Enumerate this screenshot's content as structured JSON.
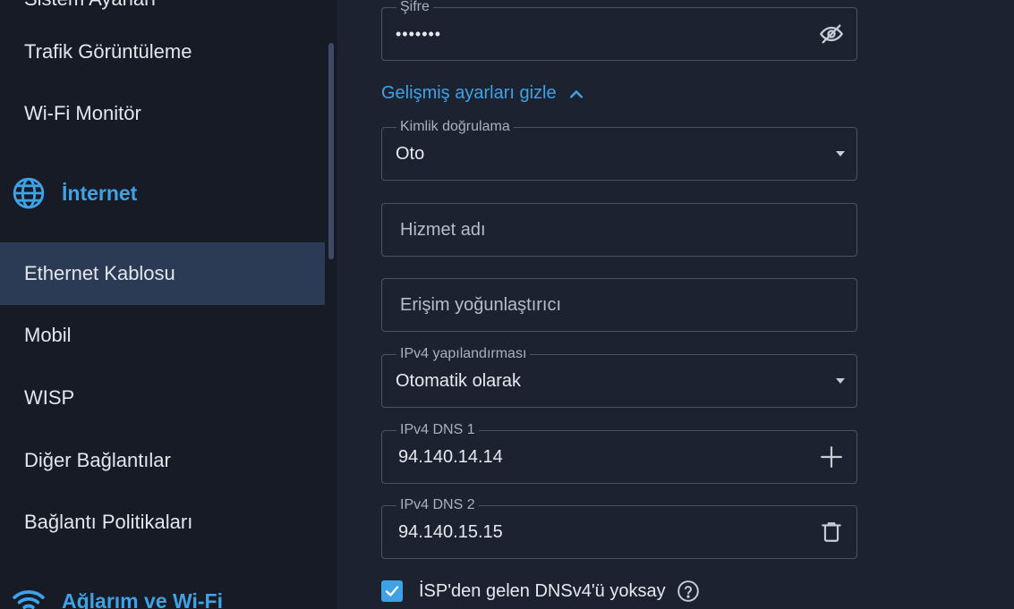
{
  "sidebar": {
    "top_fragment": "Sistem Ayarları",
    "items_top": [
      {
        "label": "Trafik Görüntüleme"
      },
      {
        "label": "Wi-Fi Monitör"
      }
    ],
    "section_internet": {
      "label": "İnternet",
      "icon": "globe-icon"
    },
    "items_internet": [
      {
        "label": "Ethernet Kablosu",
        "active": true
      },
      {
        "label": "Mobil"
      },
      {
        "label": "WISP"
      },
      {
        "label": "Diğer Bağlantılar"
      },
      {
        "label": "Bağlantı Politikaları"
      }
    ],
    "section_wifi": {
      "label": "Ağlarım ve Wi-Fi",
      "icon": "wifi-icon"
    }
  },
  "form": {
    "password": {
      "label": "Şifre",
      "value": "•••••••",
      "icon": "eye-off-icon"
    },
    "advanced_toggle": {
      "label": "Gelişmiş ayarları gizle",
      "icon": "chevron-up-icon"
    },
    "auth": {
      "label": "Kimlik doğrulama",
      "value": "Oto"
    },
    "service_name": {
      "placeholder": "Hizmet adı"
    },
    "access_concentrator": {
      "placeholder": "Erişim yoğunlaştırıcı"
    },
    "ipv4_config": {
      "label": "IPv4 yapılandırması",
      "value": "Otomatik olarak"
    },
    "dns1": {
      "label": "IPv4 DNS 1",
      "value": "94.140.14.14",
      "icon": "plus-icon"
    },
    "dns2": {
      "label": "IPv4 DNS 2",
      "value": "94.140.15.15",
      "icon": "trash-icon"
    },
    "ignore_isp_dns": {
      "label": "İSP'den gelen DNSv4'ü yoksay",
      "checked": true,
      "icon": "help-icon"
    }
  },
  "colors": {
    "accent": "#3fa2e6",
    "background": "#1c2230",
    "sidebar": "#161b26",
    "active_item": "#2b3a55"
  }
}
